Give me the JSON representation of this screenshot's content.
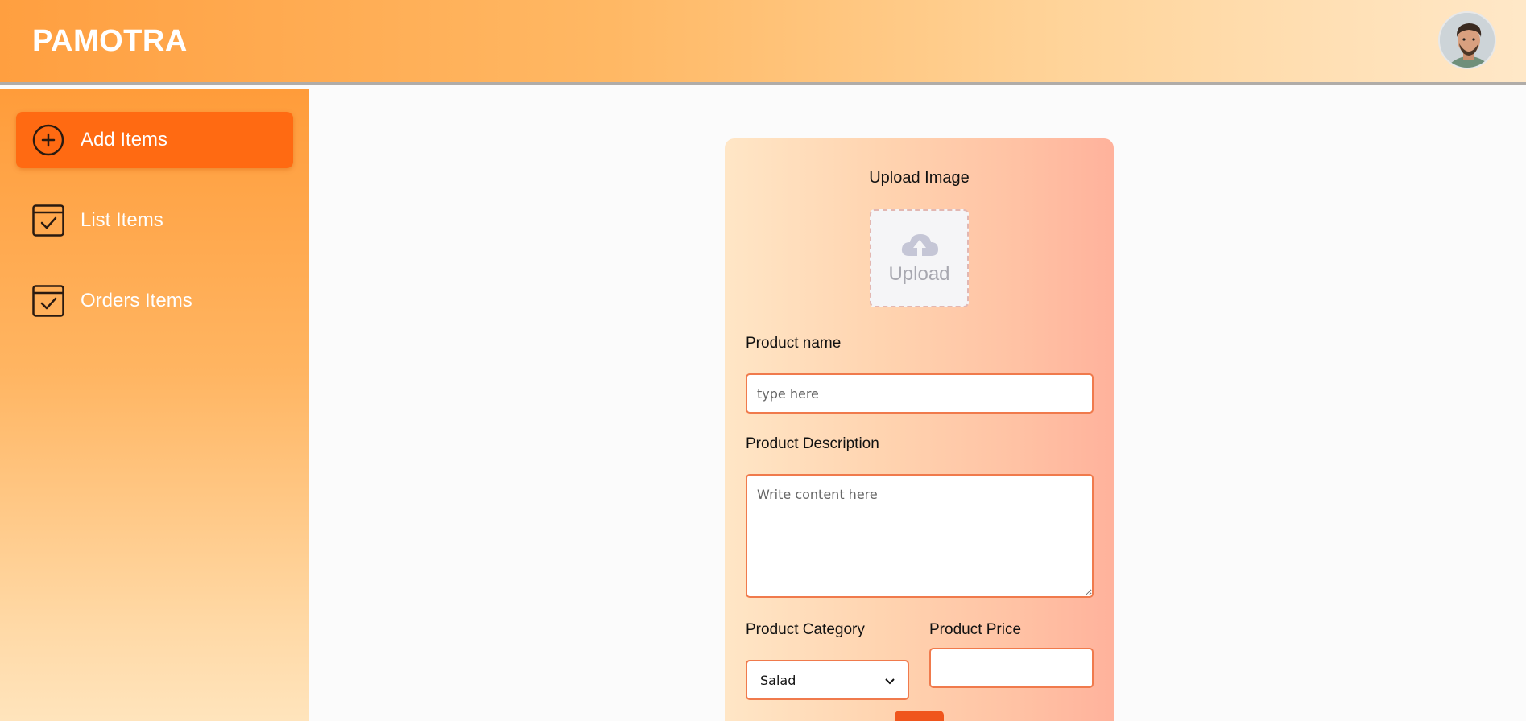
{
  "header": {
    "brand": "PAMOTRA",
    "avatar_alt": "profile"
  },
  "sidebar": {
    "items": [
      {
        "label": "Add Items",
        "icon": "add-circle-icon",
        "active": true
      },
      {
        "label": "List Items",
        "icon": "calendar-check-icon",
        "active": false
      },
      {
        "label": "Orders Items",
        "icon": "calendar-check-icon",
        "active": false
      }
    ]
  },
  "form": {
    "upload_title": "Upload Image",
    "upload_button_text": "Upload",
    "product_name_label": "Product name",
    "product_name_placeholder": "type here",
    "product_description_label": "Product Description",
    "product_description_placeholder": "Write content here",
    "product_category_label": "Product Category",
    "product_category_value": "Salad",
    "product_price_label": "Product Price",
    "product_price_value": ""
  },
  "colors": {
    "accent": "#ff6a12",
    "input_border": "#f07a4c",
    "submit": "#f0551c"
  }
}
